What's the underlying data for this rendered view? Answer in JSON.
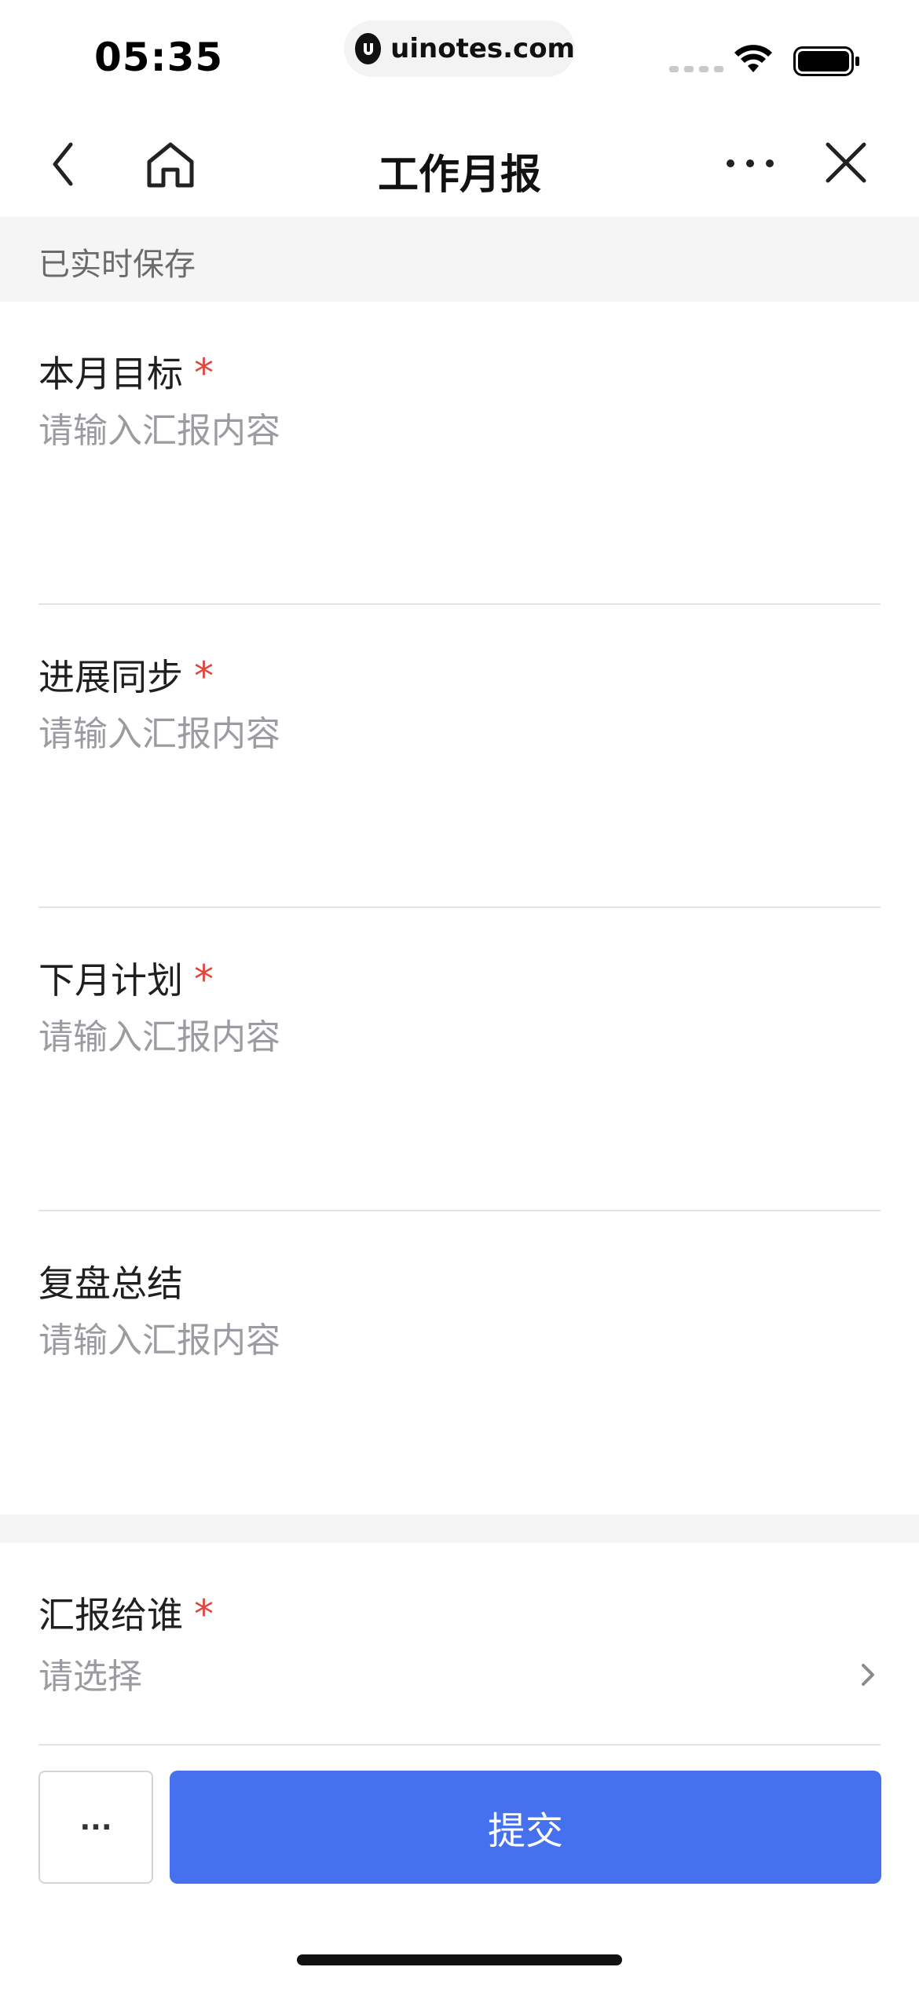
{
  "status_bar": {
    "time": "05:35",
    "url": "uinotes.com",
    "icons": [
      "signal-icon",
      "wifi-icon",
      "battery-icon"
    ]
  },
  "nav": {
    "title": "工作月报",
    "icons": [
      "back-icon",
      "home-icon",
      "more-icon",
      "close-icon"
    ]
  },
  "saved_status": "已实时保存",
  "fields": [
    {
      "label": "本月目标",
      "required_mark": "*",
      "placeholder": "请输入汇报内容"
    },
    {
      "label": "进展同步",
      "required_mark": "*",
      "placeholder": "请输入汇报内容"
    },
    {
      "label": "下月计划",
      "required_mark": "*",
      "placeholder": "请输入汇报内容"
    },
    {
      "label": "复盘总结",
      "placeholder": "请输入汇报内容"
    }
  ],
  "recipient": {
    "label": "汇报给谁",
    "required_mark": "*",
    "placeholder": "请选择"
  },
  "actions": {
    "more_label": "···",
    "submit_label": "提交"
  },
  "colors": {
    "accent": "#4570ee",
    "required": "#e0463d",
    "placeholder": "#9b9ba1"
  }
}
